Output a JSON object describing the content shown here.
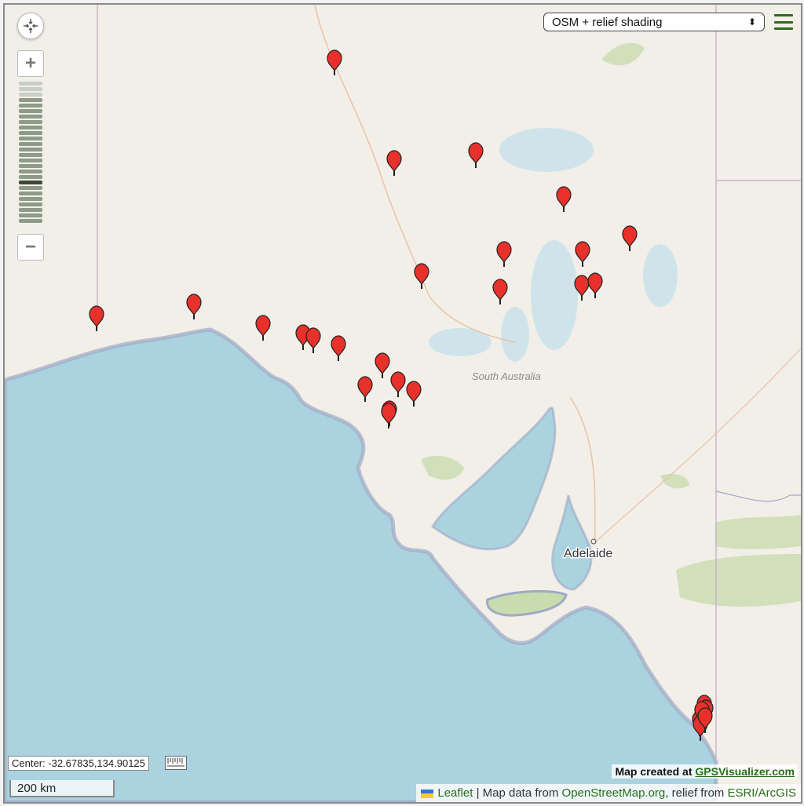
{
  "map": {
    "place_labels": {
      "region": "South Australia",
      "city": "Adelaide"
    },
    "marker_count": 30,
    "colors": {
      "sea": "#aad3df",
      "land": "#f2efe9",
      "coast": "#9fa9c4",
      "marker": "#e8312a",
      "park": "#c8dcae"
    }
  },
  "controls": {
    "recenter_icon": "crosshair-arrows-icon",
    "zoom_in_label": "+",
    "zoom_out_label": "−",
    "zoom_level_index": 18,
    "zoom_level_count": 26
  },
  "layer_selector": {
    "selected": "OSM + relief shading",
    "arrow": "⬍"
  },
  "menu": {
    "icon": "hamburger-menu-icon"
  },
  "center_readout": {
    "label": "Center:",
    "value": "-32.67835,134.90125"
  },
  "scale": {
    "label": "200 km"
  },
  "credit": {
    "prefix": "Map created at ",
    "link": "GPSVisualizer.com"
  },
  "attribution": {
    "leaflet": "Leaflet",
    "sep": " | Map data from ",
    "osm": "OpenStreetMap.org",
    "relief": ", relief from ",
    "esri": "ESRI/ArcGIS"
  }
}
